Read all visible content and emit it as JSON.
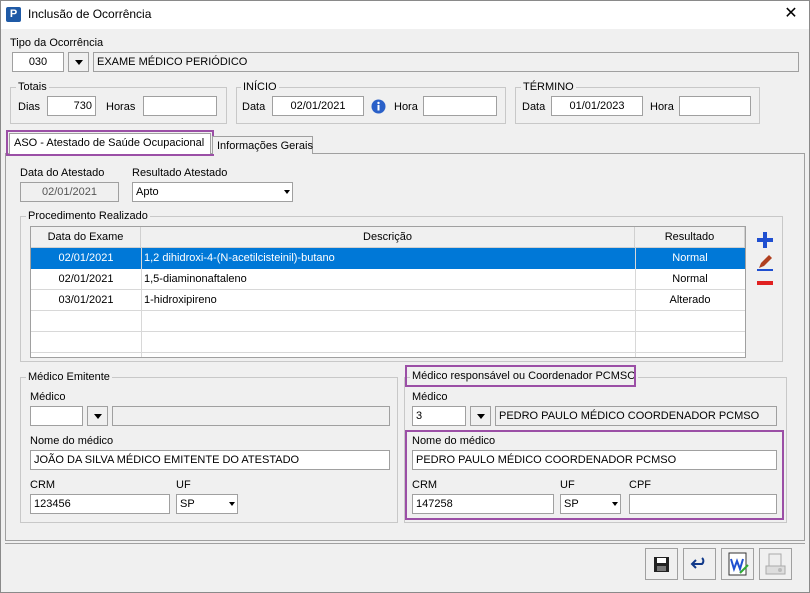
{
  "window": {
    "title": "Inclusão de Ocorrência",
    "app_icon": "P",
    "close_glyph": "✕"
  },
  "tipo": {
    "label": "Tipo da Ocorrência",
    "code": "030",
    "description": "EXAME MÉDICO PERIÓDICO"
  },
  "totais": {
    "legend": "Totais",
    "dias_label": "Dias",
    "dias_value": "730",
    "horas_label": "Horas",
    "horas_value": ""
  },
  "inicio": {
    "legend": "INÍCIO",
    "data_label": "Data",
    "data_value": "02/01/2021",
    "hora_label": "Hora",
    "hora_value": ""
  },
  "termino": {
    "legend": "TÉRMINO",
    "data_label": "Data",
    "data_value": "01/01/2023",
    "hora_label": "Hora",
    "hora_value": ""
  },
  "tabs": [
    {
      "label": "ASO - Atestado de Saúde Ocupacional",
      "active": true
    },
    {
      "label": "Informações Gerais",
      "active": false
    }
  ],
  "aso": {
    "data_atestado_label": "Data do Atestado",
    "data_atestado_value": "02/01/2021",
    "resultado_label": "Resultado Atestado",
    "resultado_value": "Apto"
  },
  "procedimento": {
    "legend": "Procedimento Realizado",
    "columns": [
      "Data do Exame",
      "Descrição",
      "Resultado"
    ],
    "rows": [
      {
        "data": "02/01/2021",
        "descricao": "1,2 dihidroxi-4-(N-acetilcisteinil)-butano",
        "resultado": "Normal",
        "selected": true
      },
      {
        "data": "02/01/2021",
        "descricao": "1,5-diaminonaftaleno",
        "resultado": "Normal",
        "selected": false
      },
      {
        "data": "03/01/2021",
        "descricao": "1-hidroxipireno",
        "resultado": "Alterado",
        "selected": false
      }
    ]
  },
  "emitente": {
    "legend": "Médico Emitente",
    "medico_label": "Médico",
    "medico_code": "",
    "medico_desc": "",
    "nome_label": "Nome do médico",
    "nome_value": "JOÃO DA SILVA MÉDICO EMITENTE DO ATESTADO",
    "crm_label": "CRM",
    "crm_value": "123456",
    "uf_label": "UF",
    "uf_value": "SP"
  },
  "coordenador": {
    "legend": "Médico responsável ou Coordenador PCMSO",
    "medico_label": "Médico",
    "medico_code": "3",
    "medico_desc": "PEDRO PAULO MÉDICO COORDENADOR PCMSO",
    "nome_label": "Nome do médico",
    "nome_value": "PEDRO PAULO MÉDICO COORDENADOR PCMSO",
    "crm_label": "CRM",
    "crm_value": "147258",
    "uf_label": "UF",
    "uf_value": "SP",
    "cpf_label": "CPF",
    "cpf_value": ""
  },
  "colors": {
    "accent_highlight": "#9b4fa6",
    "selection": "#0078d7",
    "add_icon": "#1f4fd0",
    "remove_icon": "#e02020"
  }
}
